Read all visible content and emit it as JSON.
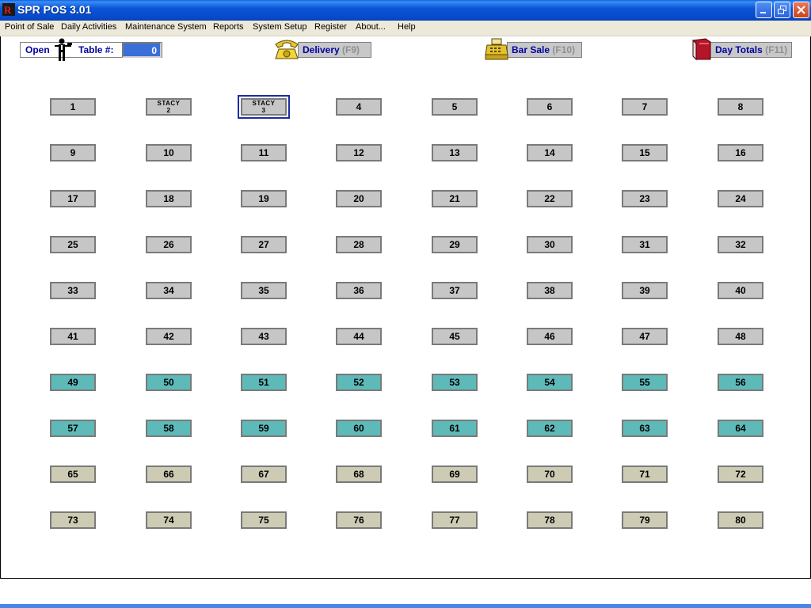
{
  "window": {
    "title": "SPR POS 3.01"
  },
  "menu": [
    "Point of Sale",
    "Daily Activities",
    "Maintenance System",
    "Reports",
    "System Setup",
    "Register",
    "About...",
    "Help"
  ],
  "toolbar": {
    "open_label": "Open",
    "table_label": "Table #:",
    "table_value": "0",
    "delivery_label": "Delivery",
    "delivery_key": "(F9)",
    "bar_sale_label": "Bar Sale",
    "bar_sale_key": "(F10)",
    "day_totals_label": "Day Totals",
    "day_totals_key": "(F11)"
  },
  "colors": {
    "available": "#c6c6c6",
    "teal": "#5ebab8",
    "khaki": "#cdcbb3",
    "selected_outline": "#1b2d9e"
  },
  "tables": [
    {
      "label": "1",
      "status": "available"
    },
    {
      "label": "STACY 2",
      "line1": "STACY",
      "line2": "2",
      "status": "occupied"
    },
    {
      "label": "STACY 3",
      "line1": "STACY",
      "line2": "3",
      "status": "occupied",
      "selected": true
    },
    {
      "label": "4"
    },
    {
      "label": "5"
    },
    {
      "label": "6"
    },
    {
      "label": "7"
    },
    {
      "label": "8"
    },
    {
      "label": "9"
    },
    {
      "label": "10"
    },
    {
      "label": "11"
    },
    {
      "label": "12"
    },
    {
      "label": "13"
    },
    {
      "label": "14"
    },
    {
      "label": "15"
    },
    {
      "label": "16"
    },
    {
      "label": "17"
    },
    {
      "label": "18"
    },
    {
      "label": "19"
    },
    {
      "label": "20"
    },
    {
      "label": "21"
    },
    {
      "label": "22"
    },
    {
      "label": "23"
    },
    {
      "label": "24"
    },
    {
      "label": "25"
    },
    {
      "label": "26"
    },
    {
      "label": "27"
    },
    {
      "label": "28"
    },
    {
      "label": "29"
    },
    {
      "label": "30"
    },
    {
      "label": "31"
    },
    {
      "label": "32"
    },
    {
      "label": "33"
    },
    {
      "label": "34"
    },
    {
      "label": "35"
    },
    {
      "label": "36"
    },
    {
      "label": "37"
    },
    {
      "label": "38"
    },
    {
      "label": "39"
    },
    {
      "label": "40"
    },
    {
      "label": "41"
    },
    {
      "label": "42"
    },
    {
      "label": "43"
    },
    {
      "label": "44"
    },
    {
      "label": "45"
    },
    {
      "label": "46"
    },
    {
      "label": "47"
    },
    {
      "label": "48"
    },
    {
      "label": "49",
      "color": "teal"
    },
    {
      "label": "50",
      "color": "teal"
    },
    {
      "label": "51",
      "color": "teal"
    },
    {
      "label": "52",
      "color": "teal"
    },
    {
      "label": "53",
      "color": "teal"
    },
    {
      "label": "54",
      "color": "teal"
    },
    {
      "label": "55",
      "color": "teal"
    },
    {
      "label": "56",
      "color": "teal"
    },
    {
      "label": "57",
      "color": "teal"
    },
    {
      "label": "58",
      "color": "teal"
    },
    {
      "label": "59",
      "color": "teal"
    },
    {
      "label": "60",
      "color": "teal"
    },
    {
      "label": "61",
      "color": "teal"
    },
    {
      "label": "62",
      "color": "teal"
    },
    {
      "label": "63",
      "color": "teal"
    },
    {
      "label": "64",
      "color": "teal"
    },
    {
      "label": "65",
      "color": "khaki"
    },
    {
      "label": "66",
      "color": "khaki"
    },
    {
      "label": "67",
      "color": "khaki"
    },
    {
      "label": "68",
      "color": "khaki"
    },
    {
      "label": "69",
      "color": "khaki"
    },
    {
      "label": "70",
      "color": "khaki"
    },
    {
      "label": "71",
      "color": "khaki"
    },
    {
      "label": "72",
      "color": "khaki"
    },
    {
      "label": "73",
      "color": "khaki"
    },
    {
      "label": "74",
      "color": "khaki"
    },
    {
      "label": "75",
      "color": "khaki"
    },
    {
      "label": "76",
      "color": "khaki"
    },
    {
      "label": "77",
      "color": "khaki"
    },
    {
      "label": "78",
      "color": "khaki"
    },
    {
      "label": "79",
      "color": "khaki"
    },
    {
      "label": "80",
      "color": "khaki"
    }
  ]
}
